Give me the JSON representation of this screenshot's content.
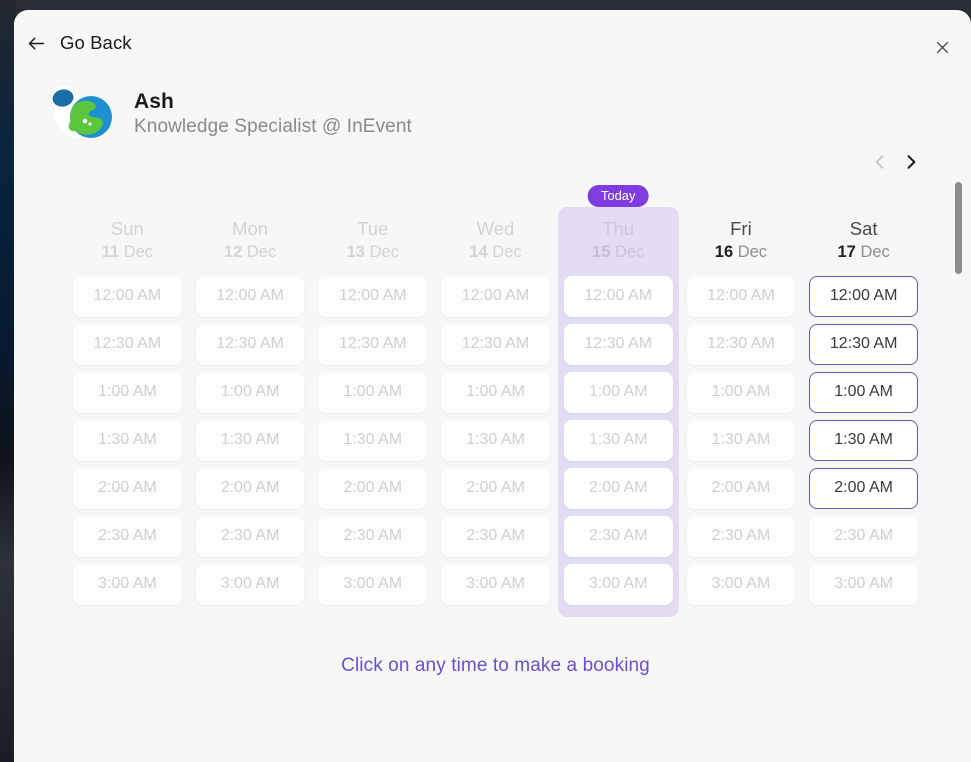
{
  "window": {
    "back_label": "Go Back",
    "close_icon": "close-icon",
    "back_icon": "arrow-left-icon"
  },
  "profile": {
    "avatar_icon": "globe-avatar",
    "name": "Ash",
    "role": "Knowledge Specialist @ InEvent"
  },
  "navigation": {
    "prev_icon": "chevron-left-icon",
    "prev_enabled": false,
    "next_icon": "chevron-right-icon",
    "next_enabled": true
  },
  "calendar": {
    "today_badge": "Today",
    "days": [
      {
        "name": "Sun",
        "num": "11",
        "month": "Dec",
        "state": "past",
        "today": false,
        "slots": [
          {
            "label": "12:00 AM",
            "state": "disabled"
          },
          {
            "label": "12:30 AM",
            "state": "disabled"
          },
          {
            "label": "1:00 AM",
            "state": "disabled"
          },
          {
            "label": "1:30 AM",
            "state": "disabled"
          },
          {
            "label": "2:00 AM",
            "state": "disabled"
          },
          {
            "label": "2:30 AM",
            "state": "disabled"
          },
          {
            "label": "3:00 AM",
            "state": "disabled"
          }
        ]
      },
      {
        "name": "Mon",
        "num": "12",
        "month": "Dec",
        "state": "past",
        "today": false,
        "slots": [
          {
            "label": "12:00 AM",
            "state": "disabled"
          },
          {
            "label": "12:30 AM",
            "state": "disabled"
          },
          {
            "label": "1:00 AM",
            "state": "disabled"
          },
          {
            "label": "1:30 AM",
            "state": "disabled"
          },
          {
            "label": "2:00 AM",
            "state": "disabled"
          },
          {
            "label": "2:30 AM",
            "state": "disabled"
          },
          {
            "label": "3:00 AM",
            "state": "disabled"
          }
        ]
      },
      {
        "name": "Tue",
        "num": "13",
        "month": "Dec",
        "state": "past",
        "today": false,
        "slots": [
          {
            "label": "12:00 AM",
            "state": "disabled"
          },
          {
            "label": "12:30 AM",
            "state": "disabled"
          },
          {
            "label": "1:00 AM",
            "state": "disabled"
          },
          {
            "label": "1:30 AM",
            "state": "disabled"
          },
          {
            "label": "2:00 AM",
            "state": "disabled"
          },
          {
            "label": "2:30 AM",
            "state": "disabled"
          },
          {
            "label": "3:00 AM",
            "state": "disabled"
          }
        ]
      },
      {
        "name": "Wed",
        "num": "14",
        "month": "Dec",
        "state": "past",
        "today": false,
        "slots": [
          {
            "label": "12:00 AM",
            "state": "disabled"
          },
          {
            "label": "12:30 AM",
            "state": "disabled"
          },
          {
            "label": "1:00 AM",
            "state": "disabled"
          },
          {
            "label": "1:30 AM",
            "state": "disabled"
          },
          {
            "label": "2:00 AM",
            "state": "disabled"
          },
          {
            "label": "2:30 AM",
            "state": "disabled"
          },
          {
            "label": "3:00 AM",
            "state": "disabled"
          }
        ]
      },
      {
        "name": "Thu",
        "num": "15",
        "month": "Dec",
        "state": "today",
        "today": true,
        "slots": [
          {
            "label": "12:00 AM",
            "state": "disabled"
          },
          {
            "label": "12:30 AM",
            "state": "disabled"
          },
          {
            "label": "1:00 AM",
            "state": "disabled"
          },
          {
            "label": "1:30 AM",
            "state": "disabled"
          },
          {
            "label": "2:00 AM",
            "state": "disabled"
          },
          {
            "label": "2:30 AM",
            "state": "disabled"
          },
          {
            "label": "3:00 AM",
            "state": "disabled"
          }
        ]
      },
      {
        "name": "Fri",
        "num": "16",
        "month": "Dec",
        "state": "future",
        "today": false,
        "slots": [
          {
            "label": "12:00 AM",
            "state": "disabled"
          },
          {
            "label": "12:30 AM",
            "state": "disabled"
          },
          {
            "label": "1:00 AM",
            "state": "disabled"
          },
          {
            "label": "1:30 AM",
            "state": "disabled"
          },
          {
            "label": "2:00 AM",
            "state": "disabled"
          },
          {
            "label": "2:30 AM",
            "state": "disabled"
          },
          {
            "label": "3:00 AM",
            "state": "disabled"
          }
        ]
      },
      {
        "name": "Sat",
        "num": "17",
        "month": "Dec",
        "state": "future",
        "today": false,
        "slots": [
          {
            "label": "12:00 AM",
            "state": "available"
          },
          {
            "label": "12:30 AM",
            "state": "available"
          },
          {
            "label": "1:00 AM",
            "state": "available"
          },
          {
            "label": "1:30 AM",
            "state": "available"
          },
          {
            "label": "2:00 AM",
            "state": "available"
          },
          {
            "label": "2:30 AM",
            "state": "disabled"
          },
          {
            "label": "3:00 AM",
            "state": "disabled"
          }
        ]
      }
    ],
    "footer_note": "Click on any time to make a booking"
  },
  "colors": {
    "accent_purple": "#7f3ce0",
    "footer_purple": "#6b4fd0",
    "today_column": "#e4dcf3",
    "slot_border": "#6f4fb0",
    "modal_bg": "#f7f7f6"
  }
}
